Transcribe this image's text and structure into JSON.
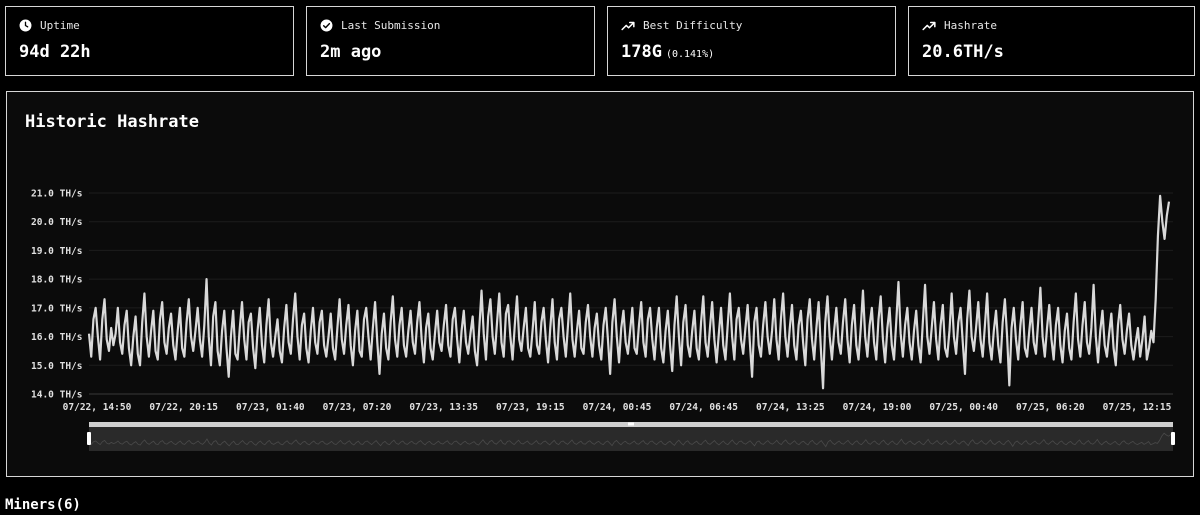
{
  "stats": [
    {
      "label": "Uptime",
      "value": "94d 22h",
      "sub": "",
      "icon": "clock-icon"
    },
    {
      "label": "Last Submission",
      "value": "2m ago",
      "sub": "",
      "icon": "check-circle-icon"
    },
    {
      "label": "Best Difficulty",
      "value": "178G",
      "sub": "(0.141%)",
      "icon": "trending-up-icon"
    },
    {
      "label": "Hashrate",
      "value": "20.6TH/s",
      "sub": "",
      "icon": "trending-up-icon"
    }
  ],
  "chart_title": "Historic Hashrate",
  "miners_heading": "Miners(6)",
  "colors": {
    "line": "#d9d9d9",
    "border": "#d6d6d6",
    "chart_bg": "#0b0b0b",
    "grid": "#1c1c1c"
  },
  "chart_data": {
    "type": "line",
    "title": "Historic Hashrate",
    "xlabel": "",
    "ylabel": "",
    "y_unit": "TH/s",
    "ylim": [
      14.0,
      21.0
    ],
    "y_ticks": [
      14.0,
      15.0,
      16.0,
      17.0,
      18.0,
      19.0,
      20.0,
      21.0
    ],
    "y_tick_labels": [
      "14.0 TH/s",
      "15.0 TH/s",
      "16.0 TH/s",
      "17.0 TH/s",
      "18.0 TH/s",
      "19.0 TH/s",
      "20.0 TH/s",
      "21.0 TH/s"
    ],
    "x_tick_labels": [
      "07/22, 14:50",
      "07/22, 20:15",
      "07/23, 01:40",
      "07/23, 07:20",
      "07/23, 13:35",
      "07/23, 19:15",
      "07/24, 00:45",
      "07/24, 06:45",
      "07/24, 13:25",
      "07/24, 19:00",
      "07/25, 00:40",
      "07/25, 06:20",
      "07/25, 12:15"
    ],
    "grid": "horizontal",
    "legend": "none",
    "series": [
      {
        "values": [
          16.1,
          15.3,
          16.6,
          17.0,
          16.0,
          15.2,
          16.6,
          17.3,
          15.9,
          15.5,
          16.3,
          15.7,
          16.1,
          17.0,
          15.8,
          15.4,
          16.4,
          16.9,
          15.6,
          15.0,
          16.0,
          16.7,
          15.4,
          15.0,
          16.5,
          17.5,
          16.0,
          15.3,
          16.2,
          16.9,
          15.5,
          15.2,
          16.6,
          17.2,
          15.8,
          15.4,
          16.3,
          16.8,
          15.7,
          15.2,
          16.2,
          17.0,
          15.6,
          15.3,
          16.5,
          17.3,
          16.0,
          15.5,
          16.2,
          17.0,
          15.9,
          15.3,
          16.4,
          18.0,
          16.0,
          15.0,
          16.7,
          17.2,
          15.5,
          15.0,
          16.2,
          16.9,
          15.6,
          14.6,
          16.0,
          16.9,
          15.4,
          15.2,
          16.3,
          17.2,
          15.9,
          15.2,
          16.5,
          16.8,
          15.6,
          14.9,
          16.2,
          17.0,
          15.7,
          15.1,
          16.4,
          17.3,
          15.8,
          15.3,
          16.0,
          16.6,
          15.5,
          15.1,
          16.3,
          17.1,
          15.8,
          15.4,
          16.6,
          17.5,
          16.0,
          15.2,
          16.4,
          16.8,
          15.6,
          15.1,
          16.2,
          17.0,
          15.8,
          15.4,
          16.5,
          16.9,
          15.7,
          15.3,
          16.0,
          16.8,
          15.6,
          15.2,
          16.3,
          17.3,
          15.9,
          15.4,
          16.4,
          17.1,
          15.7,
          15.0,
          16.2,
          16.9,
          15.5,
          15.3,
          16.6,
          17.0,
          16.0,
          15.2,
          16.3,
          17.2,
          15.8,
          14.7,
          16.1,
          16.8,
          15.6,
          15.2,
          16.5,
          17.4,
          15.9,
          15.3,
          16.4,
          17.0,
          15.7,
          15.3,
          16.2,
          16.9,
          15.8,
          15.4,
          16.5,
          17.2,
          15.9,
          15.1,
          16.3,
          16.8,
          15.6,
          15.2,
          16.1,
          16.9,
          15.8,
          15.5,
          16.4,
          17.1,
          15.7,
          15.3,
          16.6,
          17.0,
          15.9,
          15.1,
          16.2,
          16.9,
          15.8,
          15.4,
          16.1,
          16.7,
          15.5,
          15.0,
          16.3,
          17.6,
          16.1,
          15.2,
          16.7,
          17.3,
          16.0,
          15.4,
          16.5,
          17.5,
          15.8,
          15.3,
          16.8,
          17.1,
          16.0,
          15.2,
          16.4,
          17.4,
          15.9,
          15.5,
          16.3,
          17.0,
          15.6,
          15.3,
          16.2,
          17.2,
          15.7,
          15.4,
          16.5,
          17.0,
          15.9,
          15.1,
          16.3,
          17.3,
          15.8,
          15.2,
          16.6,
          17.0,
          16.0,
          15.3,
          16.4,
          17.5,
          15.9,
          15.3,
          16.2,
          16.9,
          15.6,
          15.4,
          16.5,
          17.1,
          16.0,
          15.3,
          16.3,
          16.8,
          15.7,
          15.2,
          16.4,
          17.0,
          15.9,
          14.7,
          16.5,
          17.3,
          16.0,
          15.1,
          16.3,
          16.9,
          15.8,
          15.4,
          16.2,
          17.0,
          15.6,
          15.4,
          16.4,
          17.2,
          15.8,
          15.3,
          16.6,
          17.0,
          15.9,
          15.2,
          16.3,
          17.0,
          15.6,
          15.1,
          16.2,
          16.9,
          15.7,
          14.8,
          16.4,
          17.4,
          16.0,
          15.0,
          16.5,
          17.1,
          15.7,
          15.3,
          16.2,
          16.9,
          15.6,
          15.2,
          16.5,
          17.4,
          15.8,
          15.3,
          16.3,
          17.2,
          15.9,
          15.1,
          16.1,
          17.0,
          15.7,
          15.2,
          16.4,
          17.5,
          16.0,
          15.2,
          16.6,
          17.0,
          15.9,
          15.4,
          16.3,
          17.1,
          15.8,
          14.6,
          16.5,
          17.0,
          15.7,
          15.3,
          16.4,
          17.2,
          16.0,
          15.4,
          16.2,
          17.3,
          15.9,
          15.2,
          16.6,
          17.5,
          16.0,
          15.3,
          16.3,
          17.1,
          15.7,
          15.2,
          16.4,
          16.9,
          15.8,
          15.0,
          16.6,
          17.3,
          15.9,
          15.2,
          16.3,
          17.2,
          15.6,
          14.2,
          16.5,
          17.4,
          16.0,
          15.2,
          16.2,
          17.0,
          15.8,
          15.4,
          16.5,
          17.3,
          15.9,
          15.1,
          16.4,
          17.1,
          15.7,
          15.2,
          16.3,
          17.6,
          16.0,
          15.3,
          16.4,
          17.0,
          15.8,
          15.2,
          16.6,
          17.4,
          15.9,
          15.1,
          16.3,
          17.0,
          15.7,
          15.2,
          16.5,
          17.9,
          16.1,
          15.3,
          16.4,
          17.0,
          15.8,
          15.2,
          16.2,
          16.9,
          15.7,
          15.1,
          16.5,
          17.8,
          16.0,
          15.4,
          16.3,
          17.2,
          15.9,
          15.2,
          16.4,
          17.1,
          15.6,
          15.3,
          16.2,
          17.5,
          16.0,
          15.4,
          16.5,
          17.0,
          15.8,
          14.7,
          16.6,
          17.6,
          16.0,
          15.5,
          16.3,
          17.2,
          15.9,
          15.3,
          16.4,
          17.5,
          15.8,
          15.2,
          16.2,
          16.9,
          15.7,
          15.1,
          16.5,
          17.3,
          16.0,
          14.3,
          16.3,
          17.0,
          15.9,
          15.2,
          16.4,
          17.2,
          15.6,
          15.3,
          16.2,
          17.0,
          15.8,
          15.4,
          16.5,
          17.7,
          16.0,
          15.3,
          16.3,
          17.1,
          15.9,
          15.2,
          16.4,
          17.0,
          15.7,
          15.1,
          16.2,
          16.8,
          15.6,
          15.2,
          16.5,
          17.5,
          15.9,
          15.3,
          16.4,
          17.2,
          15.8,
          15.4,
          16.3,
          17.8,
          16.0,
          15.1,
          16.2,
          16.9,
          15.7,
          15.3,
          16.1,
          16.8,
          15.6,
          15.0,
          16.4,
          17.1,
          15.9,
          15.4,
          16.2,
          16.8,
          15.7,
          15.2,
          15.8,
          16.3,
          15.3,
          15.9,
          16.7,
          15.2,
          15.6,
          16.2,
          15.8,
          17.3,
          19.5,
          20.9,
          20.0,
          19.4,
          20.2,
          20.7
        ]
      }
    ]
  }
}
